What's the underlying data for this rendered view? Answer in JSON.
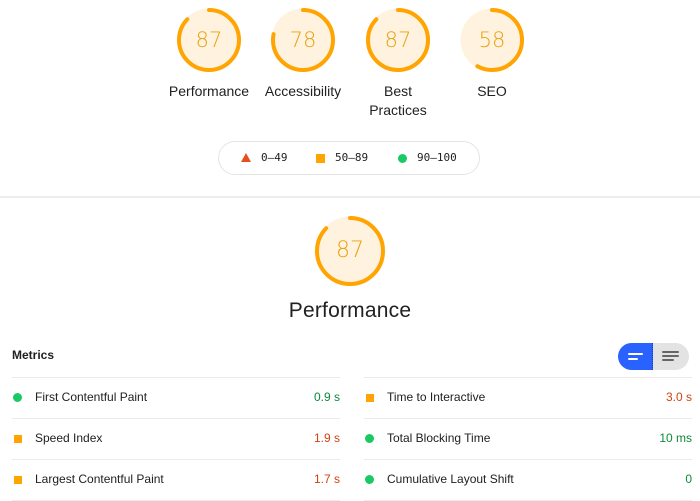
{
  "colors": {
    "fail": "#e4511e",
    "average": "#ffa400",
    "pass": "#18c964",
    "gauge_text": "#e8a10e",
    "gauge_bg": "#fff3e0",
    "value_good": "#0c8a3a",
    "value_avg": "#d4420d",
    "toggle_active": "#2962ff"
  },
  "categories": [
    {
      "label": "Performance",
      "score": 87
    },
    {
      "label": "Accessibility",
      "score": 78
    },
    {
      "label": "Best Practices",
      "score": 87
    },
    {
      "label": "SEO",
      "score": 58
    }
  ],
  "legend": [
    {
      "icon": "triangle-icon",
      "range": "0–49"
    },
    {
      "icon": "square-icon",
      "range": "50–89"
    },
    {
      "icon": "circle-icon",
      "range": "90–100"
    }
  ],
  "main": {
    "score": 87,
    "title": "Performance"
  },
  "metrics": {
    "title": "Metrics",
    "toggle": {
      "active": "compact-view",
      "options": [
        "compact-view-icon",
        "expanded-view-icon"
      ]
    },
    "left": [
      {
        "name": "First Contentful Paint",
        "value": "0.9 s",
        "status": "pass"
      },
      {
        "name": "Speed Index",
        "value": "1.9 s",
        "status": "average"
      },
      {
        "name": "Largest Contentful Paint",
        "value": "1.7 s",
        "status": "average"
      }
    ],
    "right": [
      {
        "name": "Time to Interactive",
        "value": "3.0 s",
        "status": "average"
      },
      {
        "name": "Total Blocking Time",
        "value": "10 ms",
        "status": "pass"
      },
      {
        "name": "Cumulative Layout Shift",
        "value": "0",
        "status": "pass"
      }
    ]
  }
}
